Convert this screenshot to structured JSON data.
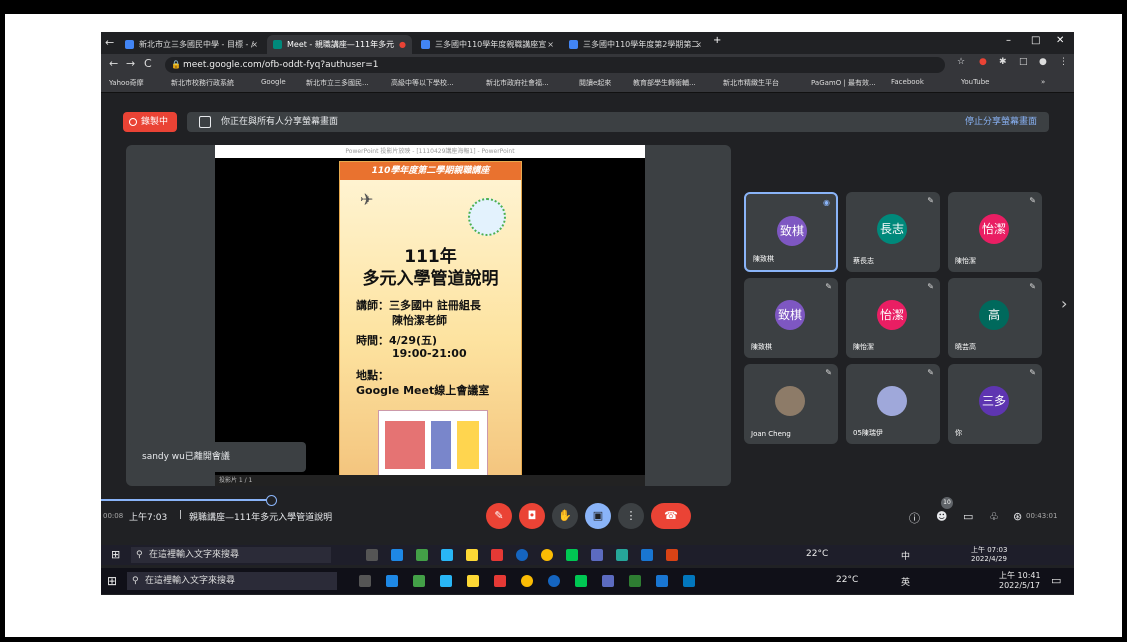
{
  "browser": {
    "tabs": [
      {
        "label": "新北市立三多國民中學 - 目標 - /",
        "color": "#4285f4"
      },
      {
        "label": "Meet - 親職講座—111年多元",
        "color": "#00897b"
      },
      {
        "label": "三多國中110學年度親職講座宣",
        "color": "#4285f4"
      },
      {
        "label": "三多國中110學年度第2學期第二",
        "color": "#4285f4"
      }
    ],
    "new_tab": "+",
    "url": "meet.google.com/ofb-oddt-fyq?authuser=1",
    "bookmarks": [
      "Yahoo奇摩",
      "新北市校務行政系統",
      "Google",
      "新北市立三多國民...",
      "高級中等以下學校...",
      "新北市政府社會福...",
      "閱讀e起來",
      "教育部學生轉銜輔...",
      "新北市精緻生平台",
      "PaGamO | 最有效...",
      "Facebook",
      "YouTube"
    ],
    "more": "»"
  },
  "meet": {
    "recording": "錄製中",
    "share_text": "你正在與所有人分享螢幕畫面",
    "stop_share": "停止分享螢幕畫面",
    "ppt_title": "PowerPoint 投影片放映 - [1110429講座海報1] - PowerPoint",
    "poster": {
      "header": "110學年度第二學期親職講座",
      "year": "111年",
      "title": "多元入學管道說明",
      "lecturer_label": "講師：三多國中 註冊組長",
      "lecturer_name": "陳怡潔老師",
      "time_label": "時間：4/29(五)",
      "time_value": "19:00-21:00",
      "place_label": "地點：",
      "place_value": "Google Meet線上會議室"
    },
    "slide_counter": "投影片 1 / 1",
    "toast": "sandy wu已離開會議",
    "participants": [
      {
        "initials": "致棋",
        "name": "陳致棋",
        "color": "#7e57c2"
      },
      {
        "initials": "長志",
        "name": "蔡長志",
        "color": "#00897b"
      },
      {
        "initials": "怡潔",
        "name": "陳怡潔",
        "color": "#e91e63"
      },
      {
        "initials": "致棋",
        "name": "陳致棋",
        "color": "#7e57c2"
      },
      {
        "initials": "怡潔",
        "name": "陳怡潔",
        "color": "#e91e63"
      },
      {
        "initials": "高",
        "name": "曉芸高",
        "color": "#00695c"
      },
      {
        "initials": "",
        "name": "Joan Cheng",
        "color": "#8d7b68"
      },
      {
        "initials": "",
        "name": "05陳瑞伊",
        "color": "#9fa8da"
      },
      {
        "initials": "三多",
        "name": "你",
        "color": "#5e35b1"
      }
    ],
    "meeting_time": "上午7:03",
    "meeting_name": "親職講座—111年多元入學管道說明",
    "elapsed_left": "00:08",
    "elapsed_right": "00:43:01",
    "people_count": "10"
  },
  "taskbar_inner": {
    "search": "在這裡輸入文字來搜尋",
    "weather": "22°C",
    "time": "上午 07:03",
    "date": "2022/4/29",
    "lang": "中"
  },
  "taskbar": {
    "search": "在這裡輸入文字來搜尋",
    "weather": "22°C",
    "time": "上午 10:41",
    "date": "2022/5/17",
    "lang": "英"
  }
}
